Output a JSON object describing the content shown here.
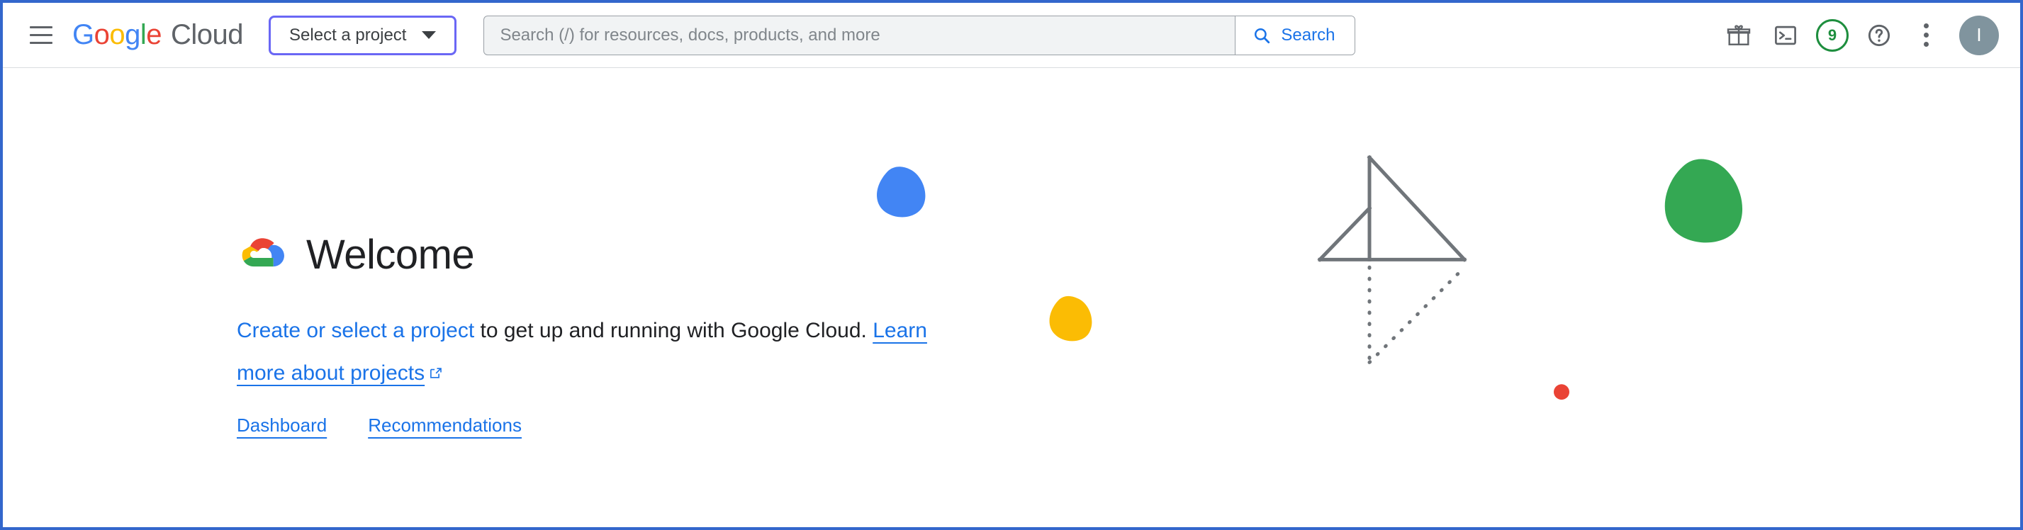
{
  "window": {
    "border_color": "#3367cc"
  },
  "header": {
    "menu_icon": "hamburger-menu-icon",
    "brand": {
      "google": "Google",
      "cloud": "Cloud",
      "letters": [
        {
          "ch": "G",
          "color": "#4285f4"
        },
        {
          "ch": "o",
          "color": "#ea4335"
        },
        {
          "ch": "o",
          "color": "#fbbc04"
        },
        {
          "ch": "g",
          "color": "#4285f4"
        },
        {
          "ch": "l",
          "color": "#34a853"
        },
        {
          "ch": "e",
          "color": "#ea4335"
        }
      ]
    },
    "project_selector": {
      "label": "Select a project",
      "icon": "chevron-down-icon",
      "border_color": "#6a67f5"
    },
    "search": {
      "placeholder": "Search (/) for resources, docs, products, and more",
      "value": "",
      "button_label": "Search",
      "button_icon": "search-icon",
      "accent_color": "#1a73e8"
    },
    "actions": [
      {
        "name": "gift-icon",
        "label": "Offers"
      },
      {
        "name": "cloud-shell-icon",
        "label": "Activate Cloud Shell"
      },
      {
        "name": "notifications-badge",
        "label": "9",
        "color": "#1e8e3e"
      },
      {
        "name": "help-icon",
        "label": "Support"
      },
      {
        "name": "kebab-menu-icon",
        "label": "More options"
      }
    ],
    "avatar": {
      "initial": "I",
      "color": "#80949e"
    }
  },
  "main": {
    "welcome": {
      "logo_icon": "google-cloud-logo-icon",
      "title": "Welcome"
    },
    "intro": {
      "link_create": "Create or select a project",
      "text_middle": " to get up and running with Google Cloud. ",
      "link_learn": "Learn more about projects",
      "learn_icon": "external-link-icon"
    },
    "quick_links": [
      {
        "label": "Dashboard",
        "name": "dashboard-link"
      },
      {
        "label": "Recommendations",
        "name": "recommendations-link"
      }
    ],
    "decoration": {
      "blue_blob_color": "#4285f4",
      "yellow_blob_color": "#fbbc04",
      "green_blob_color": "#34a853",
      "red_dot_color": "#ea4335",
      "line_art_color": "#70757a"
    }
  }
}
